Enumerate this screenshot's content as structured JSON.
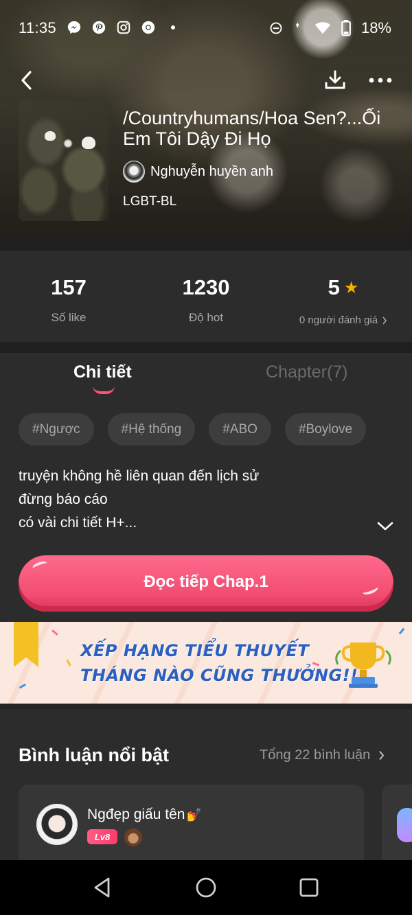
{
  "status_bar": {
    "time": "11:35",
    "battery": "18%",
    "left_icons": [
      "messenger-icon",
      "pinterest-icon",
      "instagram-icon",
      "chrome-icon",
      "dot-icon"
    ],
    "right_icons": [
      "dnd-icon",
      "data-arrows-icon",
      "wifi-icon",
      "battery-icon"
    ]
  },
  "header": {
    "title": "/Countryhumans/Hoa Sen?...Ối Em Tôi Dậy Đi Họ",
    "author": "Nghuyễn huyền anh",
    "genre": "LGBT-BL"
  },
  "stats": {
    "likes_value": "157",
    "likes_label": "Số like",
    "hot_value": "1230",
    "hot_label": "Độ hot",
    "rating_value": "5",
    "rating_label": "0 người đánh giá"
  },
  "tabs": {
    "detail": "Chi tiết",
    "chapter": "Chapter(7)"
  },
  "tags": [
    "#Ngược",
    "#Hệ thống",
    "#ABO",
    "#Boylove"
  ],
  "description": {
    "line1": "truyện không hề liên quan đến lịch sử",
    "line2": "đừng báo cáo",
    "line3": "có vài chi tiết H+..."
  },
  "read_button": "Đọc tiếp Chap.1",
  "banner": {
    "line1": "XẾP HẠNG TIỂU THUYẾT",
    "line2": "THÁNG NÀO CŨNG THƯỞNG!!"
  },
  "comments": {
    "title": "Bình luận nổi bật",
    "total": "Tổng 22 bình luận",
    "first": {
      "name": "Ngđẹp giấu tên",
      "level": "Lv8"
    }
  },
  "colors": {
    "accent": "#ff4f7b",
    "content_bg": "#2c2c2c",
    "star": "#f5b100",
    "banner_text": "#2b5fc0"
  }
}
